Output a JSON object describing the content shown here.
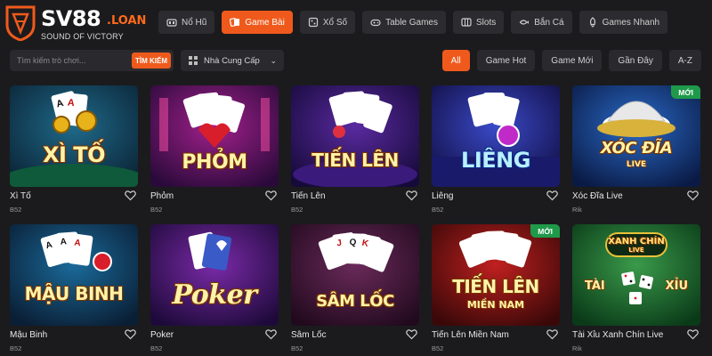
{
  "logo": {
    "text": "SV88",
    "suffix": ".LOAN",
    "slogan": "SOUND OF VICTORY"
  },
  "tabs": [
    {
      "label": "Nổ Hũ",
      "icon": "slot-jackpot-icon",
      "active": false
    },
    {
      "label": "Game Bài",
      "icon": "cards-icon",
      "active": true
    },
    {
      "label": "Xổ Số",
      "icon": "lottery-icon",
      "active": false
    },
    {
      "label": "Table Games",
      "icon": "gamepad-icon",
      "active": false
    },
    {
      "label": "Slots",
      "icon": "slots-icon",
      "active": false
    },
    {
      "label": "Bắn Cá",
      "icon": "fish-icon",
      "active": false
    },
    {
      "label": "Games Nhanh",
      "icon": "rocket-icon",
      "active": false
    }
  ],
  "search": {
    "placeholder": "Tìm kiếm trò chơi...",
    "button": "TÌM KIẾM"
  },
  "provider": {
    "label": "Nhà Cung Cấp"
  },
  "filters": [
    {
      "label": "All",
      "active": true
    },
    {
      "label": "Game Hot",
      "active": false
    },
    {
      "label": "Game Mới",
      "active": false
    },
    {
      "label": "Gần Đây",
      "active": false
    },
    {
      "label": "A-Z",
      "active": false
    }
  ],
  "games": [
    {
      "name": "Xì Tố",
      "provider": "B52",
      "art_title": "XÌ TỐ",
      "art_sub": "",
      "badge": ""
    },
    {
      "name": "Phỏm",
      "provider": "B52",
      "art_title": "PHỎM",
      "art_sub": "",
      "badge": ""
    },
    {
      "name": "Tiến Lên",
      "provider": "B52",
      "art_title": "TIẾN LÊN",
      "art_sub": "",
      "badge": ""
    },
    {
      "name": "Liêng",
      "provider": "B52",
      "art_title": "LIÊNG",
      "art_sub": "",
      "badge": ""
    },
    {
      "name": "Xóc Đĩa Live",
      "provider": "Rik",
      "art_title": "XÓC ĐĨA",
      "art_sub": "LIVE",
      "badge": "MỚI"
    },
    {
      "name": "Mậu Binh",
      "provider": "B52",
      "art_title": "MẬU BINH",
      "art_sub": "",
      "badge": ""
    },
    {
      "name": "Poker",
      "provider": "B52",
      "art_title": "Poker",
      "art_sub": "",
      "badge": ""
    },
    {
      "name": "Sâm Lốc",
      "provider": "B52",
      "art_title": "SÂM LỐC",
      "art_sub": "",
      "badge": ""
    },
    {
      "name": "Tiến Lên Miền Nam",
      "provider": "B52",
      "art_title": "TIẾN LÊN",
      "art_sub": "MIỀN NAM",
      "badge": "MỚI"
    },
    {
      "name": "Tài Xỉu Xanh Chín Live",
      "provider": "Rik",
      "art_title": "",
      "art_sub": "",
      "badge": "",
      "art_logo": "XANH CHÍN",
      "art_logo_sub": "LIVE",
      "art_left": "TÀI",
      "art_right": "XỈU"
    }
  ],
  "colors": {
    "accent": "#ef5a1c",
    "badge": "#1f9a4a",
    "background": "#1b1b1d"
  }
}
